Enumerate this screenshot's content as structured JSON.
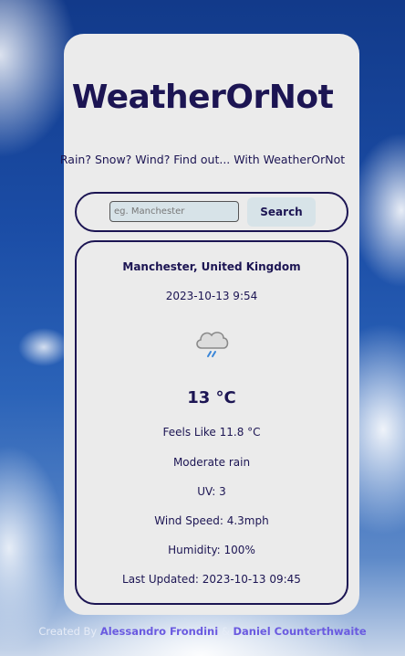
{
  "app": {
    "title": "WeatherOrNot",
    "tagline": "Rain? Snow? Wind? Find out... With WeatherOrNot"
  },
  "search": {
    "placeholder": "eg. Manchester",
    "value": "",
    "button_label": "Search"
  },
  "weather": {
    "location": "Manchester, United Kingdom",
    "local_time": "2023-10-13 9:54",
    "icon": "cloud-rain-icon",
    "temperature": "13 °C",
    "feels_like": "Feels Like 11.8 °C",
    "condition": "Moderate rain",
    "uv": "UV: 3",
    "wind_speed": "Wind Speed: 4.3mph",
    "humidity": "Humidity: 100%",
    "last_updated": "Last Updated: 2023-10-13 09:45"
  },
  "footer": {
    "prefix": "Created By",
    "author1": "Alessandro Frondini",
    "separator": "&",
    "author2": "Daniel Counterthwaite"
  },
  "colors": {
    "accent": "#1c1553",
    "card_bg": "#ebebeb",
    "input_bg": "#d7e3e8",
    "link": "#6a5ae0"
  }
}
